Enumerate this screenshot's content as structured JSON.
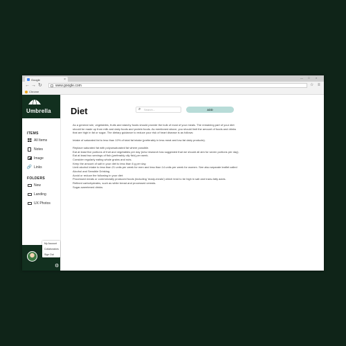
{
  "browser": {
    "tab_title": "Google",
    "tab_close": "×",
    "url": "www.google.com",
    "bookmark": "Chrome",
    "window_controls": [
      "—",
      "□",
      "×"
    ]
  },
  "sidebar": {
    "brand": "Umbrella",
    "items_heading": "ITEMS",
    "items": [
      {
        "label": "All Items",
        "icon": "grid-icon"
      },
      {
        "label": "Notes",
        "icon": "notes-icon"
      },
      {
        "label": "Image",
        "icon": "image-icon"
      },
      {
        "label": "Links",
        "icon": "link-icon"
      }
    ],
    "folders_heading": "FOLDERS",
    "folders": [
      {
        "label": "New",
        "icon": "folder-icon"
      },
      {
        "label": "Landing",
        "icon": "folder-icon"
      },
      {
        "label": "UX Photos",
        "icon": "folder-icon"
      }
    ],
    "user_menu": [
      "My Account",
      "Collaborators",
      "Sign Out"
    ]
  },
  "main": {
    "title": "Diet",
    "search_placeholder": "Search...",
    "add_label": "ADD",
    "paragraphs": [
      "As a general rule, vegetables, fruits and starchy foods should provide the bulk of most of your meals. The remaining part of your diet should be made up from milk and dairy foods and protein foods. As mentioned above, you should limit the amount of foods and drinks that are high in fat or sugar. The dietary guidance to reduce your risk of heart disease is as follows:",
      "Intake of saturated fat to less than 10% of total fat intake (preferably in less meat and low-fat dairy products).",
      "Replace saturated fat with polyunsaturated fat where possible.",
      "Eat at least five portions of fruit and vegetables per day (new research has suggested that we should all aim for seven portions per day).",
      "Eat at least two servings of fish (preferably oily fish) per week.",
      "Consider regularly eating whole grains and nuts.",
      "Keep the amount of salt in your diet to less than 6 g per day.",
      "Limit alcohol intake to less than 21 units per week for men and less than 14 units per week for women. See also separate leaflet called Alcohol and Sensible Drinking.",
      "Avoid or reduce the following in your diet:",
      "Processed meats or commercially produced foods (including 'ready-meals') which tend to be high in salt and trans-fatty acids.",
      "Refined carbohydrates, such as white bread and processed cereals.",
      "Sugar-sweetened drinks."
    ]
  }
}
